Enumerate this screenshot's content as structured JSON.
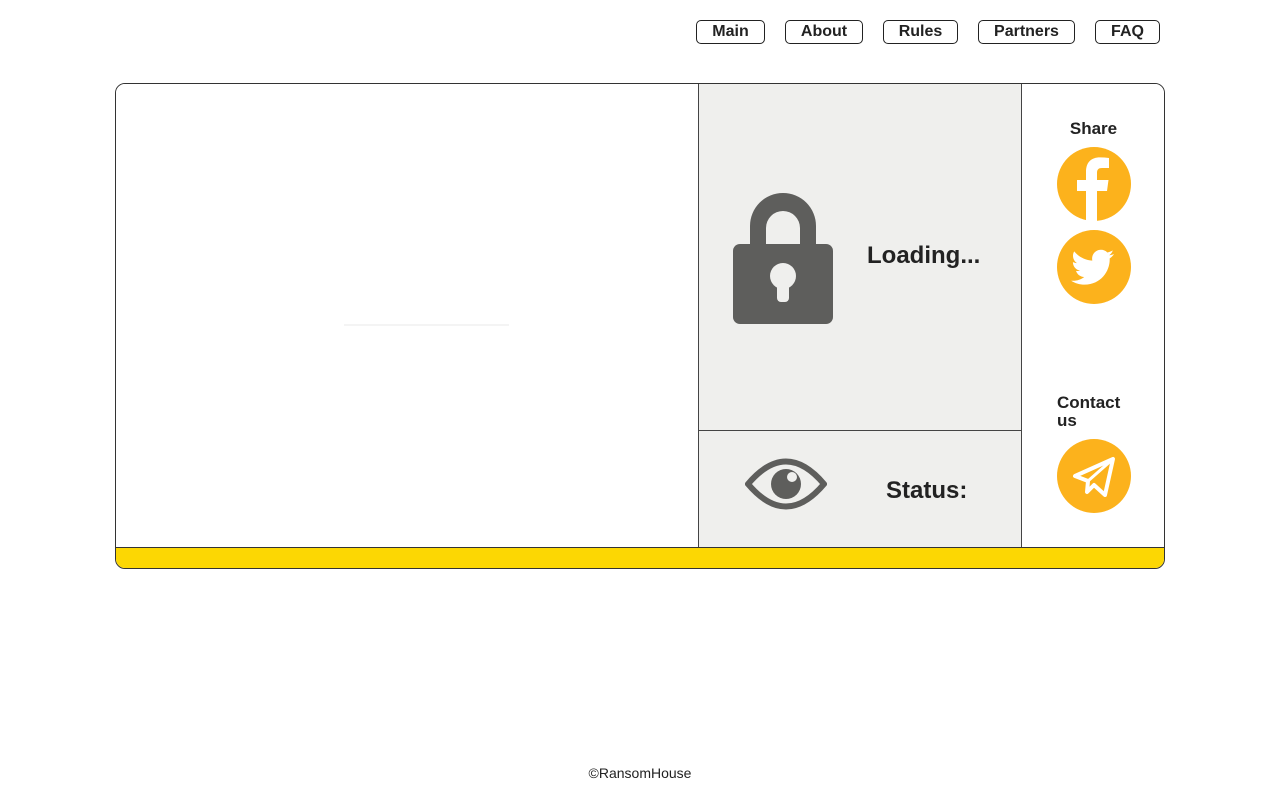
{
  "nav": {
    "items": [
      {
        "label": "Main"
      },
      {
        "label": "About"
      },
      {
        "label": "Rules"
      },
      {
        "label": "Partners"
      },
      {
        "label": "FAQ"
      }
    ]
  },
  "card": {
    "loading_text": "Loading...",
    "status_label": "Status:",
    "lock_icon": "lock-icon",
    "eye_icon": "eye-icon"
  },
  "sidebar": {
    "share_label": "Share",
    "contact_label": "Contact us",
    "social_icons": [
      "facebook-icon",
      "twitter-icon",
      "telegram-icon"
    ]
  },
  "colors": {
    "accent": "#fcb21c",
    "bar": "#fcd703",
    "panel": "#efefed",
    "icon_gray": "#5e5e5c"
  },
  "footer": {
    "copyright": "©RansomHouse"
  }
}
